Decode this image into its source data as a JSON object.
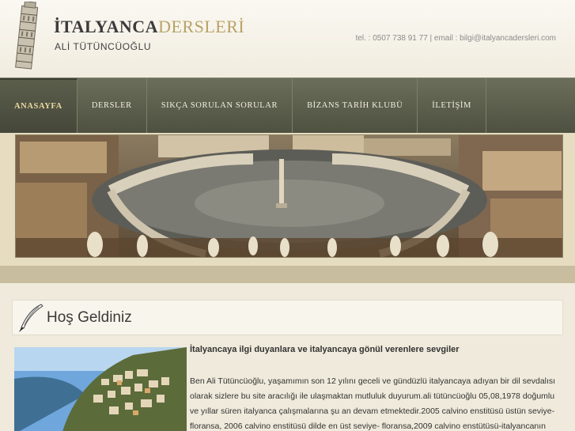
{
  "header": {
    "brand_part1": "İTALYANCA",
    "brand_part2": "DERSLERİ",
    "author": "ALİ TÜTÜNCÜOĞLU",
    "contact": "tel. : 0507 738 91 77 | email : bilgi@italyancadersleri.com"
  },
  "nav": {
    "items": [
      {
        "label": "ANASAYFA",
        "active": true
      },
      {
        "label": "DERSLER",
        "active": false
      },
      {
        "label": "SIKÇA SORULAN SORULAR",
        "active": false
      },
      {
        "label": "BİZANS TARİH KLUBÜ",
        "active": false
      },
      {
        "label": "İLETİŞİM",
        "active": false
      }
    ]
  },
  "welcome": {
    "title": "Hoş Geldiniz"
  },
  "content": {
    "intro": "İtalyancaya ilgi duyanlara ve italyancaya gönül verenlere sevgiler",
    "paragraph": "Ben Ali Tütüncüoğlu, yaşamımın son 12 yılını geceli ve gündüzlü italyancaya adıyan bir dil sevdalısı olarak sizlere bu site aracılığı ile ulaşmaktan mutluluk duyurum.ali tütüncüoğlu 05,08,1978 doğumlu ve yıllar süren italyanca çalışmalarına şu an devam etmektedir.2005 calvino enstitüsü üstün seviye-floransa, 2006 calvino enstitüsü dilde en üst seviye- floransa,2009 calvino enstütüsü-italyancanın"
  },
  "colors": {
    "nav_bg": "#4e5140",
    "nav_active_text": "#ecd9a2",
    "brand_accent": "#b9a266",
    "page_bg": "#efeadb"
  },
  "icons": [
    "leaning-tower-logo-icon",
    "quill-icon"
  ]
}
